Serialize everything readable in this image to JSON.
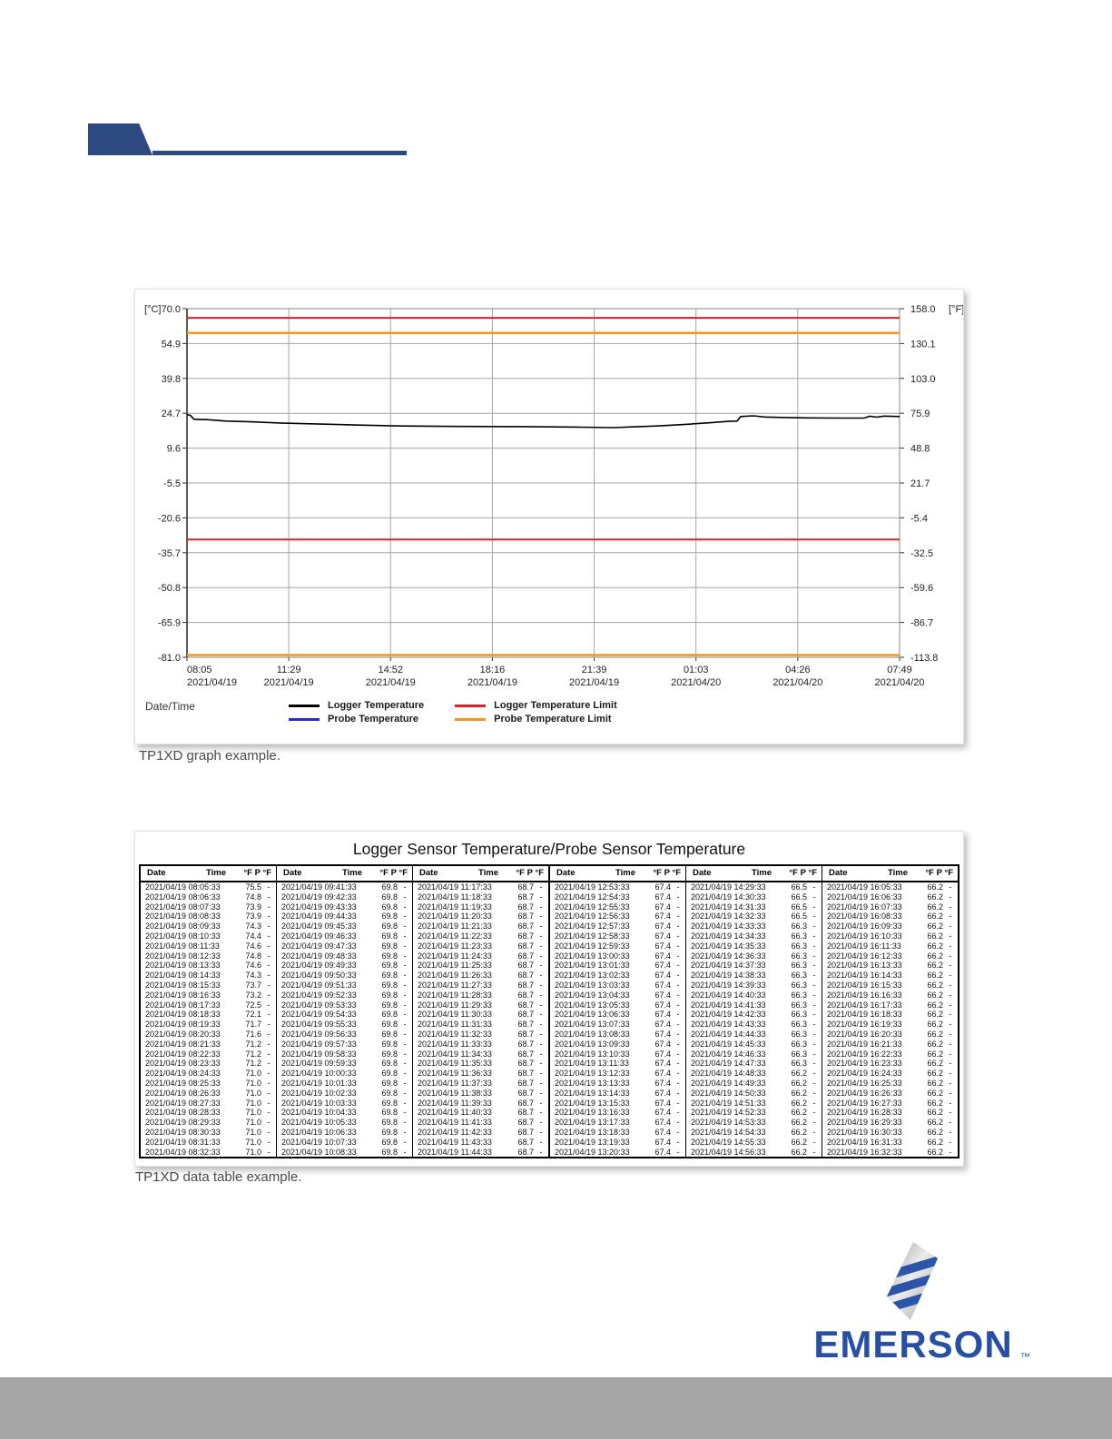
{
  "page": {
    "captions": {
      "graph": "TP1XD graph example.",
      "table": "TP1XD data table example."
    }
  },
  "graph": {
    "y_axis_left": {
      "unit_label": "[°C]",
      "ticks": [
        "70.0",
        "54.9",
        "39.8",
        "24.7",
        "9.6",
        "-5.5",
        "-20.6",
        "-35.7",
        "-50.8",
        "-65.9",
        "-81.0"
      ]
    },
    "y_axis_right": {
      "unit_label": "[°F]",
      "ticks": [
        "158.0",
        "130.1",
        "103.0",
        "75.9",
        "48.8",
        "21.7",
        "-5.4",
        "-32.5",
        "-59.6",
        "-86.7",
        "-113.8"
      ]
    },
    "x_axis": {
      "label": "Date/Time",
      "ticks": [
        {
          "time": "08:05",
          "date": "2021/04/19"
        },
        {
          "time": "11:29",
          "date": "2021/04/19"
        },
        {
          "time": "14:52",
          "date": "2021/04/19"
        },
        {
          "time": "18:16",
          "date": "2021/04/19"
        },
        {
          "time": "21:39",
          "date": "2021/04/19"
        },
        {
          "time": "01:03",
          "date": "2021/04/20"
        },
        {
          "time": "04:26",
          "date": "2021/04/20"
        },
        {
          "time": "07:49",
          "date": "2021/04/20"
        }
      ]
    },
    "legend": [
      {
        "name": "Logger Temperature",
        "color": "#000000"
      },
      {
        "name": "Probe Temperature",
        "color": "#2929d6"
      },
      {
        "name": "Logger Temperature Limit",
        "color": "#e31e24"
      },
      {
        "name": "Probe Temperature Limit",
        "color": "#f7941d"
      }
    ]
  },
  "chart_data": {
    "type": "line",
    "title": "",
    "ylabel_left": "[°C]",
    "ylabel_right": "[°F]",
    "ylim_c": [
      -81.0,
      70.0
    ],
    "ylim_f": [
      -113.8,
      158.0
    ],
    "grid": true,
    "x_tick_count": 8,
    "series": [
      {
        "name": "Logger Temperature",
        "color": "#000000",
        "points_frac_c": [
          [
            0.0,
            24.2
          ],
          [
            0.005,
            23.7
          ],
          [
            0.01,
            22.1
          ],
          [
            0.03,
            21.9
          ],
          [
            0.055,
            21.3
          ],
          [
            0.09,
            21.0
          ],
          [
            0.13,
            20.5
          ],
          [
            0.18,
            20.1
          ],
          [
            0.24,
            19.6
          ],
          [
            0.3,
            19.2
          ],
          [
            0.38,
            19.0
          ],
          [
            0.47,
            18.9
          ],
          [
            0.55,
            18.7
          ],
          [
            0.6,
            18.5
          ],
          [
            0.625,
            18.8
          ],
          [
            0.66,
            19.2
          ],
          [
            0.7,
            19.9
          ],
          [
            0.735,
            20.6
          ],
          [
            0.76,
            21.2
          ],
          [
            0.772,
            21.3
          ],
          [
            0.777,
            23.3
          ],
          [
            0.795,
            23.6
          ],
          [
            0.81,
            23.1
          ],
          [
            0.835,
            22.9
          ],
          [
            0.87,
            22.7
          ],
          [
            0.92,
            22.6
          ],
          [
            0.95,
            22.6
          ],
          [
            0.958,
            23.4
          ],
          [
            0.968,
            23.0
          ],
          [
            0.978,
            23.5
          ],
          [
            1.0,
            23.3
          ]
        ]
      },
      {
        "name": "Probe Temperature",
        "color": "#2929d6",
        "points_frac_c": []
      },
      {
        "name": "Logger Temperature Limit",
        "color": "#e31e24",
        "high_c": 66.0,
        "low_c": -30.0
      },
      {
        "name": "Probe Temperature Limit",
        "color": "#f7941d",
        "high_c": 59.5,
        "low_c": -80.0
      }
    ]
  },
  "table": {
    "title": "Logger Sensor Temperature/Probe Sensor Temperature",
    "headers": {
      "date": "Date",
      "time": "Time",
      "f": "°F",
      "pf": "P °F"
    },
    "groups": [
      {
        "date": "2021/04/19",
        "p": "-",
        "times": [
          "08:05:33",
          "08:06:33",
          "08:07:33",
          "08:08:33",
          "08:09:33",
          "08:10:33",
          "08:11:33",
          "08:12:33",
          "08:13:33",
          "08:14:33",
          "08:15:33",
          "08:16:33",
          "08:17:33",
          "08:18:33",
          "08:19:33",
          "08:20:33",
          "08:21:33",
          "08:22:33",
          "08:23:33",
          "08:24:33",
          "08:25:33",
          "08:26:33",
          "08:27:33",
          "08:28:33",
          "08:29:33",
          "08:30:33",
          "08:31:33",
          "08:32:33"
        ],
        "values": [
          "75.5",
          "74.8",
          "73.9",
          "73.9",
          "74.3",
          "74.4",
          "74.6",
          "74.8",
          "74.6",
          "74.3",
          "73.7",
          "73.2",
          "72.5",
          "72.1",
          "71.7",
          "71.6",
          "71.2",
          "71.2",
          "71.2",
          "71.0",
          "71.0",
          "71.0",
          "71.0",
          "71.0",
          "71.0",
          "71.0",
          "71.0",
          "71.0"
        ]
      },
      {
        "date": "2021/04/19",
        "p": "-",
        "times": [
          "09:41:33",
          "09:42:33",
          "09:43:33",
          "09:44:33",
          "09:45:33",
          "09:46:33",
          "09:47:33",
          "09:48:33",
          "09:49:33",
          "09:50:33",
          "09:51:33",
          "09:52:33",
          "09:53:33",
          "09:54:33",
          "09:55:33",
          "09:56:33",
          "09:57:33",
          "09:58:33",
          "09:59:33",
          "10:00:33",
          "10:01:33",
          "10:02:33",
          "10:03:33",
          "10:04:33",
          "10:05:33",
          "10:06:33",
          "10:07:33",
          "10:08:33"
        ],
        "values": [
          "69.8",
          "69.8",
          "69.8",
          "69.8",
          "69.8",
          "69.8",
          "69.8",
          "69.8",
          "69.8",
          "69.8",
          "69.8",
          "69.8",
          "69.8",
          "69.8",
          "69.8",
          "69.8",
          "69.8",
          "69.8",
          "69.8",
          "69.8",
          "69.8",
          "69.8",
          "69.8",
          "69.8",
          "69.8",
          "69.8",
          "69.8",
          "69.8"
        ]
      },
      {
        "date": "2021/04/19",
        "p": "-",
        "times": [
          "11:17:33",
          "11:18:33",
          "11:19:33",
          "11:20:33",
          "11:21:33",
          "11:22:33",
          "11:23:33",
          "11:24:33",
          "11:25:33",
          "11:26:33",
          "11:27:33",
          "11:28:33",
          "11:29:33",
          "11:30:33",
          "11:31:33",
          "11:32:33",
          "11:33:33",
          "11:34:33",
          "11:35:33",
          "11:36:33",
          "11:37:33",
          "11:38:33",
          "11:39:33",
          "11:40:33",
          "11:41:33",
          "11:42:33",
          "11:43:33",
          "11:44:33"
        ],
        "values": [
          "68.7",
          "68.7",
          "68.7",
          "68.7",
          "68.7",
          "68.7",
          "68.7",
          "68.7",
          "68.7",
          "68.7",
          "68.7",
          "68.7",
          "68.7",
          "68.7",
          "68.7",
          "68.7",
          "68.7",
          "68.7",
          "68.7",
          "68.7",
          "68.7",
          "68.7",
          "68.7",
          "68.7",
          "68.7",
          "68.7",
          "68.7",
          "68.7"
        ]
      },
      {
        "date": "2021/04/19",
        "p": "-",
        "times": [
          "12:53:33",
          "12:54:33",
          "12:55:33",
          "12:56:33",
          "12:57:33",
          "12:58:33",
          "12:59:33",
          "13:00:33",
          "13:01:33",
          "13:02:33",
          "13:03:33",
          "13:04:33",
          "13:05:33",
          "13:06:33",
          "13:07:33",
          "13:08:33",
          "13:09:33",
          "13:10:33",
          "13:11:33",
          "13:12:33",
          "13:13:33",
          "13:14:33",
          "13:15:33",
          "13:16:33",
          "13:17:33",
          "13:18:33",
          "13:19:33",
          "13:20:33"
        ],
        "values": [
          "67.4",
          "67.4",
          "67.4",
          "67.4",
          "67.4",
          "67.4",
          "67.4",
          "67.4",
          "67.4",
          "67.4",
          "67.4",
          "67.4",
          "67.4",
          "67.4",
          "67.4",
          "67.4",
          "67.4",
          "67.4",
          "67.4",
          "67.4",
          "67.4",
          "67.4",
          "67.4",
          "67.4",
          "67.4",
          "67.4",
          "67.4",
          "67.4"
        ]
      },
      {
        "date": "2021/04/19",
        "p": "-",
        "times": [
          "14:29:33",
          "14:30:33",
          "14:31:33",
          "14:32:33",
          "14:33:33",
          "14:34:33",
          "14:35:33",
          "14:36:33",
          "14:37:33",
          "14:38:33",
          "14:39:33",
          "14:40:33",
          "14:41:33",
          "14:42:33",
          "14:43:33",
          "14:44:33",
          "14:45:33",
          "14:46:33",
          "14:47:33",
          "14:48:33",
          "14:49:33",
          "14:50:33",
          "14:51:33",
          "14:52:33",
          "14:53:33",
          "14:54:33",
          "14:55:33",
          "14:56:33"
        ],
        "values": [
          "66.5",
          "66.5",
          "66.5",
          "66.5",
          "66.3",
          "66.3",
          "66.3",
          "66.3",
          "66.3",
          "66.3",
          "66.3",
          "66.3",
          "66.3",
          "66.3",
          "66.3",
          "66.3",
          "66.3",
          "66.3",
          "66.3",
          "66.2",
          "66.2",
          "66.2",
          "66.2",
          "66.2",
          "66.2",
          "66.2",
          "66.2",
          "66.2"
        ]
      },
      {
        "date": "2021/04/19",
        "p": "-",
        "times": [
          "16:05:33",
          "16:06:33",
          "16:07:33",
          "16:08:33",
          "16:09:33",
          "16:10:33",
          "16:11:33",
          "16:12:33",
          "16:13:33",
          "16:14:33",
          "16:15:33",
          "16:16:33",
          "16:17:33",
          "16:18:33",
          "16:19:33",
          "16:20:33",
          "16:21:33",
          "16:22:33",
          "16:23:33",
          "16:24:33",
          "16:25:33",
          "16:26:33",
          "16:27:33",
          "16:28:33",
          "16:29:33",
          "16:30:33",
          "16:31:33",
          "16:32:33"
        ],
        "values": [
          "66.2",
          "66.2",
          "66.2",
          "66.2",
          "66.2",
          "66.2",
          "66.2",
          "66.2",
          "66.2",
          "66.2",
          "66.2",
          "66.2",
          "66.2",
          "66.2",
          "66.2",
          "66.2",
          "66.2",
          "66.2",
          "66.2",
          "66.2",
          "66.2",
          "66.2",
          "66.2",
          "66.2",
          "66.2",
          "66.2",
          "66.2",
          "66.2"
        ]
      }
    ]
  },
  "logo": {
    "brand": "EMERSON",
    "tm": "™"
  },
  "colors": {
    "header_navy": "#2c4a80",
    "footer_gray": "#a6a6a6",
    "emerson_blue": "#2750a5",
    "grid_gray": "#a6a6a6"
  }
}
